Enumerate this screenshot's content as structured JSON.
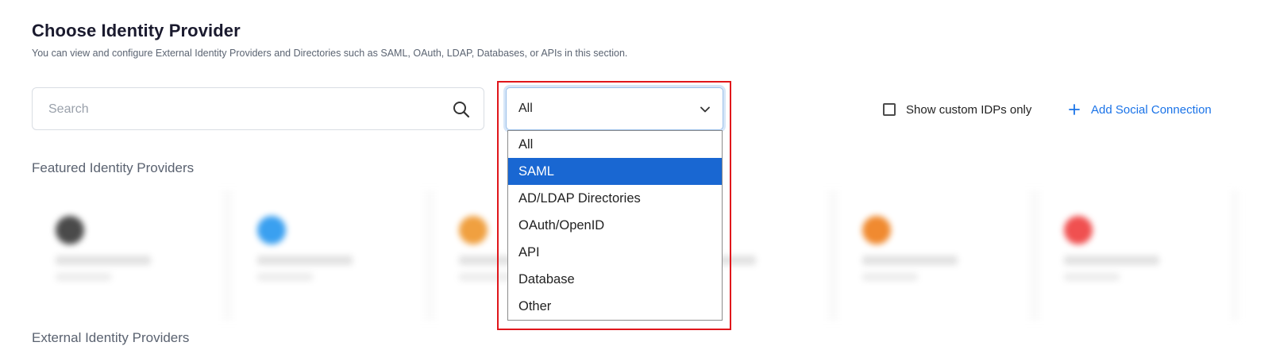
{
  "header": {
    "title": "Choose Identity Provider",
    "subtitle": "You can view and configure External Identity Providers and Directories such as SAML, OAuth, LDAP, Databases, or APIs in this section."
  },
  "search": {
    "placeholder": "Search",
    "value": "",
    "icon": "search-icon"
  },
  "filter": {
    "selected": "All",
    "highlighted_option": "SAML",
    "options": [
      "All",
      "SAML",
      "AD/LDAP Directories",
      "OAuth/OpenID",
      "API",
      "Database",
      "Other"
    ]
  },
  "custom_idp_checkbox": {
    "label": "Show custom IDPs only",
    "checked": false
  },
  "add_social": {
    "label": "Add Social Connection",
    "icon": "plus-icon"
  },
  "sections": {
    "featured": "Featured Identity Providers",
    "external": "External Identity Providers"
  },
  "colors": {
    "accent": "#1a73e8",
    "option_selected_bg": "#1967d2",
    "highlight_border": "#e0161b"
  },
  "featured_card_logo_colors": [
    "#4a4a4a",
    "#3aa0f0",
    "#f0a040",
    "#9aa0a6",
    "#f08a30",
    "#f05050"
  ]
}
